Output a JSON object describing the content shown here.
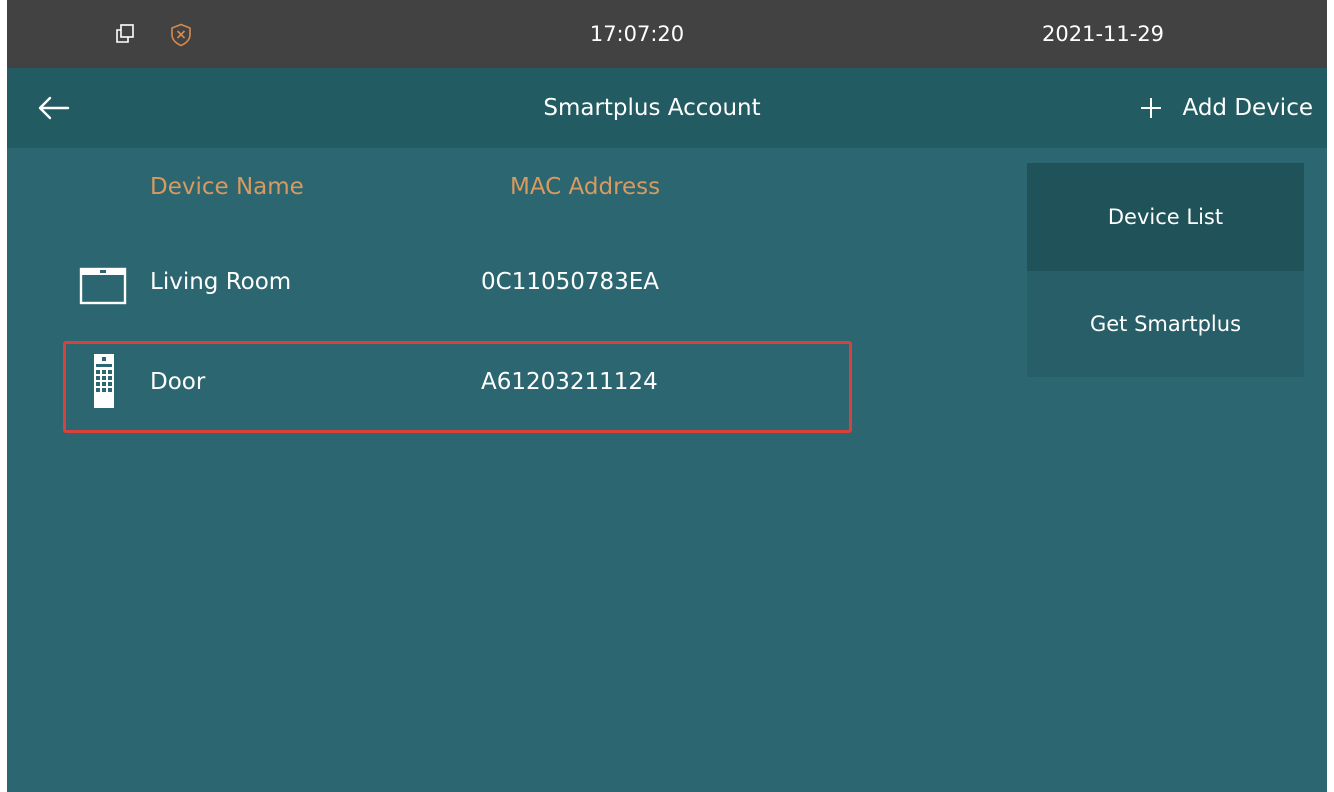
{
  "status_bar": {
    "time": "17:07:20",
    "date": "2021-11-29",
    "icons": [
      "window-restore-icon",
      "shield-x-icon"
    ]
  },
  "header": {
    "back_icon": "arrow-left-icon",
    "title": "Smartplus Account",
    "add_device_label": "Add Device",
    "add_icon": "plus-icon"
  },
  "table": {
    "columns": [
      "Device Name",
      "MAC Address"
    ],
    "rows": [
      {
        "icon": "indoor-monitor-icon",
        "name": "Living Room",
        "mac": "0C11050783EA",
        "highlighted": false
      },
      {
        "icon": "door-phone-icon",
        "name": "Door",
        "mac": "A61203211124",
        "highlighted": true
      }
    ]
  },
  "side_menu": {
    "items": [
      {
        "label": "Device List",
        "active": true
      },
      {
        "label": "Get Smartplus",
        "active": false
      }
    ]
  },
  "colors": {
    "background": "#2c6670",
    "status_bar": "#424242",
    "title_bar": "#225b61",
    "column_header": "#d89a5e",
    "highlight_border": "#d9423c",
    "shield_icon": "#d98a4a"
  }
}
